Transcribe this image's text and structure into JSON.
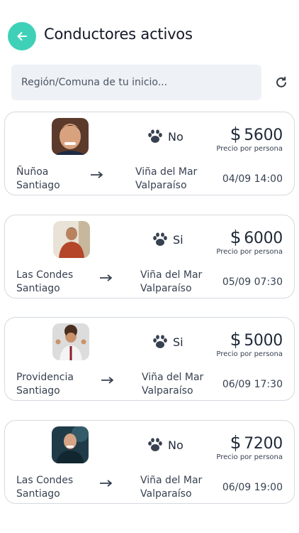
{
  "header": {
    "title": "Conductores activos"
  },
  "search": {
    "placeholder": "Región/Comuna de tu inicio..."
  },
  "card_labels": {
    "price_note": "Precio por persona",
    "currency": "$"
  },
  "colors": {
    "accent": "#3fd1b8",
    "card_border": "#d5d9df",
    "search_bg": "#eef1f6"
  },
  "trips": [
    {
      "pets": "No",
      "price": "5600",
      "origin_line1": "Ñuñoa",
      "origin_line2": "Santiago",
      "dest_line1": "Viña del Mar",
      "dest_line2": "Valparaíso",
      "datetime": "04/09 14:00"
    },
    {
      "pets": "Si",
      "price": "6000",
      "origin_line1": "Las Condes",
      "origin_line2": "Santiago",
      "dest_line1": "Viña del Mar",
      "dest_line2": "Valparaíso",
      "datetime": "05/09 07:30"
    },
    {
      "pets": "Si",
      "price": "5000",
      "origin_line1": "Providencia",
      "origin_line2": "Santiago",
      "dest_line1": "Viña del Mar",
      "dest_line2": "Valparaíso",
      "datetime": "06/09 17:30"
    },
    {
      "pets": "No",
      "price": "7200",
      "origin_line1": "Las Condes",
      "origin_line2": "Santiago",
      "dest_line1": "Viña del Mar",
      "dest_line2": "Valparaíso",
      "datetime": "06/09 19:00"
    }
  ]
}
